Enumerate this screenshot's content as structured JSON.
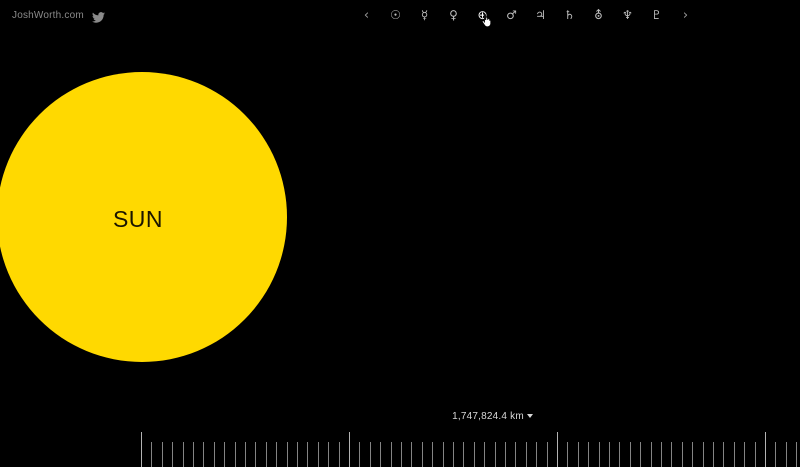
{
  "header": {
    "site_link": "JoshWorth.com",
    "twitter_icon": "twitter-bird-icon"
  },
  "nav": {
    "prev_symbol": "‹",
    "next_symbol": "›",
    "planets": [
      {
        "id": "sun",
        "symbol": "☉",
        "icon": "sun-symbol-icon"
      },
      {
        "id": "mercury",
        "symbol": "☿",
        "icon": "mercury-symbol-icon"
      },
      {
        "id": "venus",
        "symbol": "♀",
        "icon": "venus-symbol-icon"
      },
      {
        "id": "earth",
        "symbol": "⊕",
        "icon": "earth-symbol-icon",
        "active": true
      },
      {
        "id": "mars",
        "symbol": "♂",
        "icon": "mars-symbol-icon"
      },
      {
        "id": "jupiter",
        "symbol": "♃",
        "icon": "jupiter-symbol-icon"
      },
      {
        "id": "saturn",
        "symbol": "♄",
        "icon": "saturn-symbol-icon"
      },
      {
        "id": "uranus",
        "symbol": "⛢",
        "icon": "uranus-symbol-icon"
      },
      {
        "id": "neptune",
        "symbol": "♆",
        "icon": "neptune-symbol-icon"
      },
      {
        "id": "pluto",
        "symbol": "♇",
        "icon": "pluto-symbol-icon"
      }
    ]
  },
  "sun": {
    "label": "SUN",
    "color": "#ffd900"
  },
  "distance": {
    "value": "1,747,824.4 km"
  },
  "colors": {
    "background": "#000000",
    "sun": "#ffd900",
    "ruler": "#bdbdbd"
  }
}
